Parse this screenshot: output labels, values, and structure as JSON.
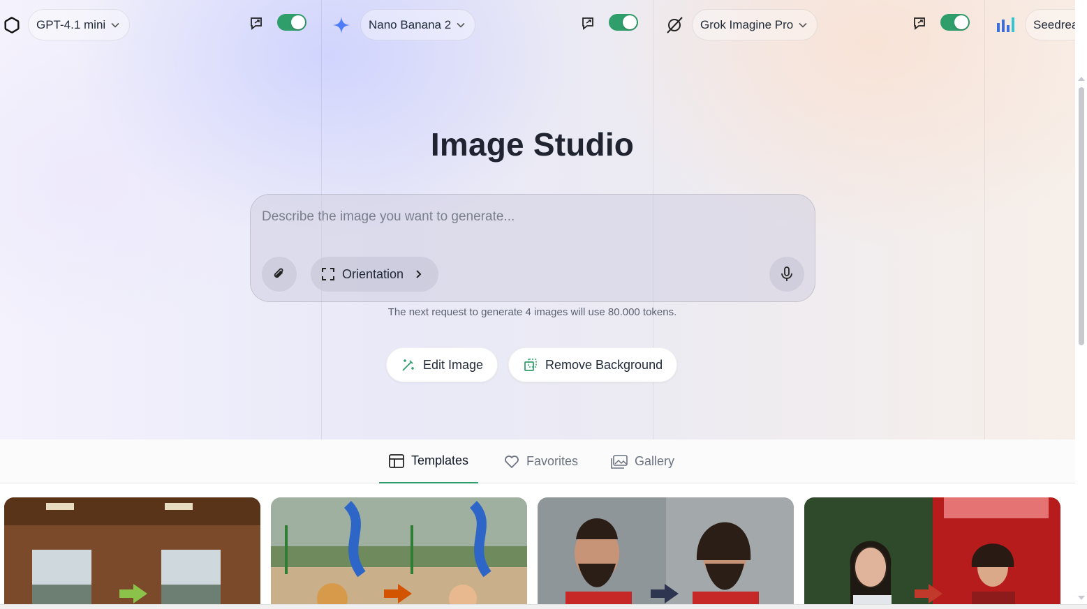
{
  "models": [
    {
      "name": "GPT-4.1 mini",
      "logo": "openai-logo-icon",
      "enabled": true
    },
    {
      "name": "Nano Banana 2",
      "logo": "gemini-sparkle-icon",
      "enabled": true
    },
    {
      "name": "Grok Imagine Pro",
      "logo": "grok-logo-icon",
      "enabled": true
    },
    {
      "name": "Seedream",
      "logo": "bytedance-bars-icon",
      "enabled": true
    }
  ],
  "main": {
    "title": "Image Studio",
    "prompt_placeholder": "Describe the image you want to generate...",
    "orientation_label": "Orientation",
    "token_note": "The next request to generate 4 images will use 80.000 tokens.",
    "edit_image_label": "Edit Image",
    "remove_background_label": "Remove Background"
  },
  "tabs": [
    {
      "label": "Templates",
      "active": true
    },
    {
      "label": "Favorites",
      "active": false
    },
    {
      "label": "Gallery",
      "active": false
    }
  ],
  "colors": {
    "accent": "#2f9e6b",
    "gemini_blue": "#4f7cf7",
    "seedream_blue": "#3b6fe0"
  }
}
